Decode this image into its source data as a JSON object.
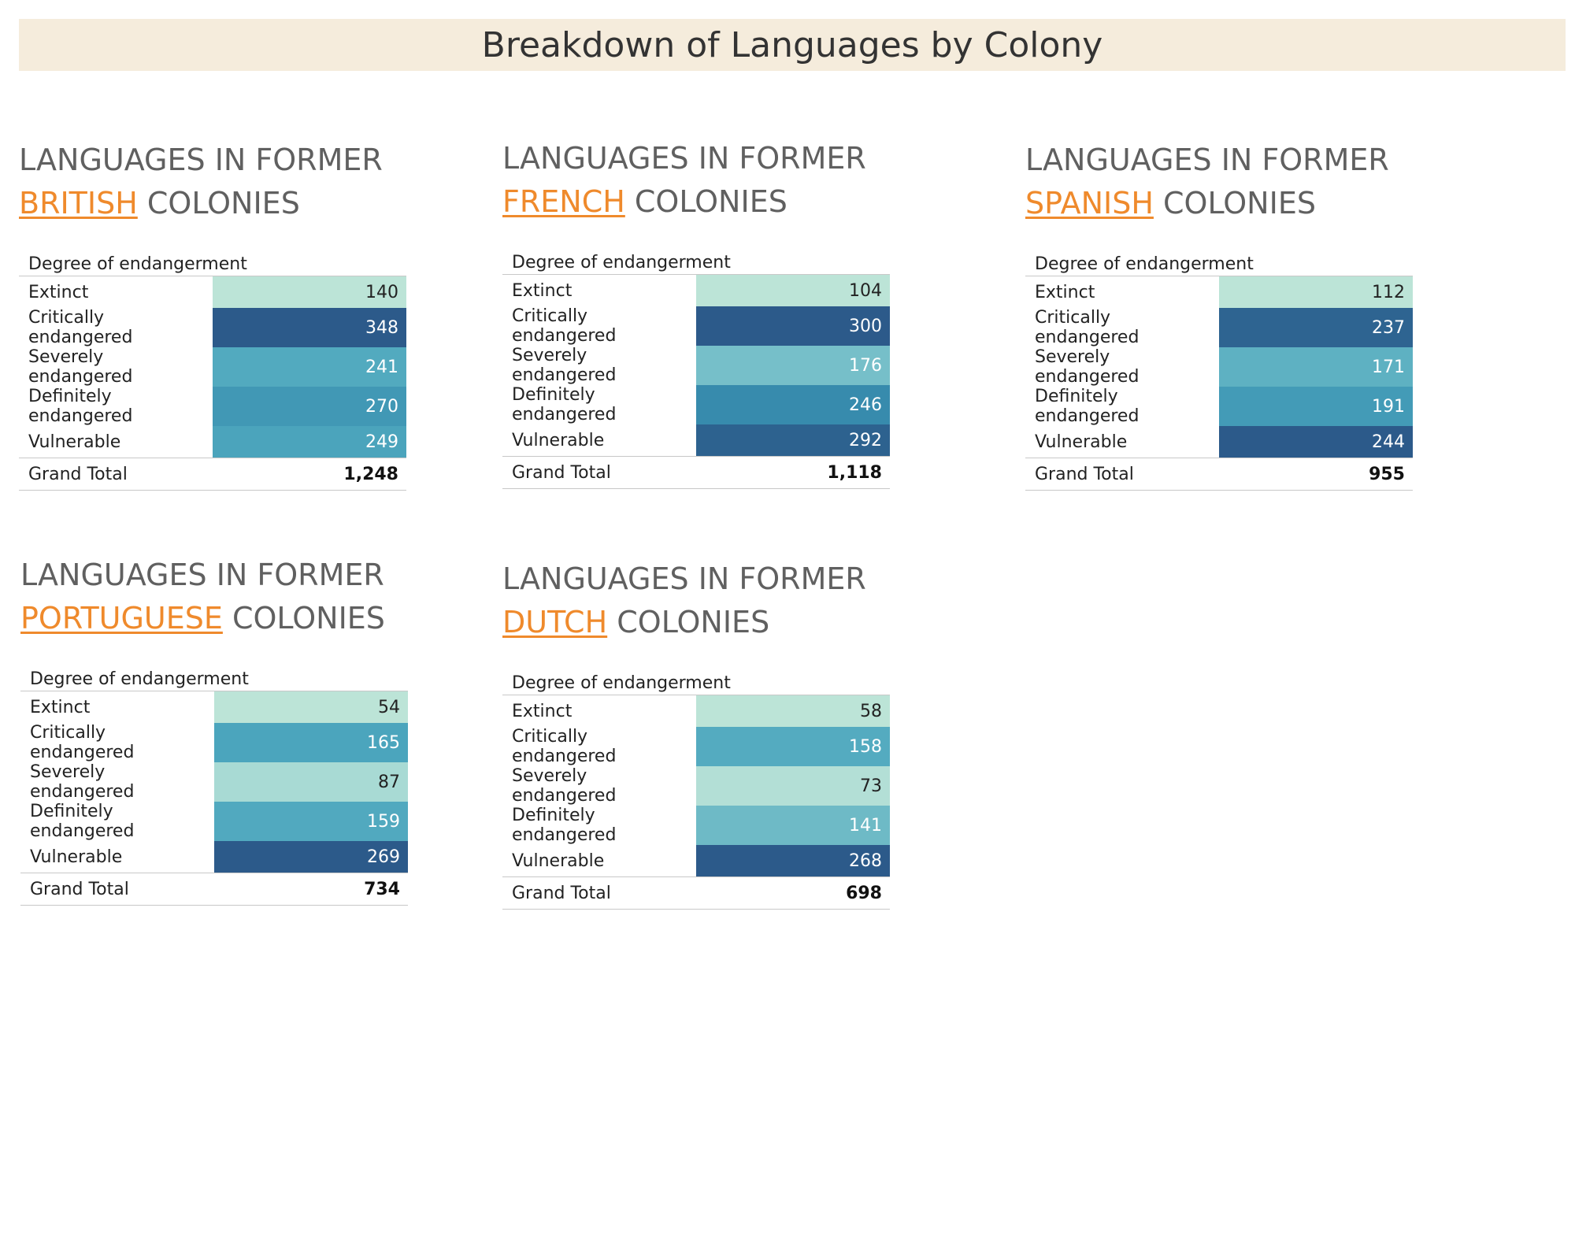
{
  "title": "Breakdown of Languages by Colony",
  "panel_title_prefix": "LANGUAGES IN FORMER",
  "panel_title_suffix": "COLONIES",
  "column_header": "Degree of endangerment",
  "total_label": "Grand Total",
  "chart_data": [
    {
      "type": "table",
      "colony": "BRITISH",
      "categories": [
        "Extinct",
        "Critically endangered",
        "Severely endangered",
        "Definitely endangered",
        "Vulnerable"
      ],
      "values": [
        140,
        348,
        241,
        270,
        249
      ],
      "total": "1,248"
    },
    {
      "type": "table",
      "colony": "FRENCH",
      "categories": [
        "Extinct",
        "Critically endangered",
        "Severely endangered",
        "Definitely endangered",
        "Vulnerable"
      ],
      "values": [
        104,
        300,
        176,
        246,
        292
      ],
      "total": "1,118"
    },
    {
      "type": "table",
      "colony": "SPANISH",
      "categories": [
        "Extinct",
        "Critically endangered",
        "Severely endangered",
        "Definitely endangered",
        "Vulnerable"
      ],
      "values": [
        112,
        237,
        171,
        191,
        244
      ],
      "total": "955"
    },
    {
      "type": "table",
      "colony": "PORTUGUESE",
      "categories": [
        "Extinct",
        "Critically endangered",
        "Severely endangered",
        "Definitely endangered",
        "Vulnerable"
      ],
      "values": [
        54,
        165,
        87,
        159,
        269
      ],
      "total": "734"
    },
    {
      "type": "table",
      "colony": "DUTCH",
      "categories": [
        "Extinct",
        "Critically endangered",
        "Severely endangered",
        "Definitely endangered",
        "Vulnerable"
      ],
      "values": [
        58,
        158,
        73,
        141,
        268
      ],
      "total": "698"
    }
  ]
}
